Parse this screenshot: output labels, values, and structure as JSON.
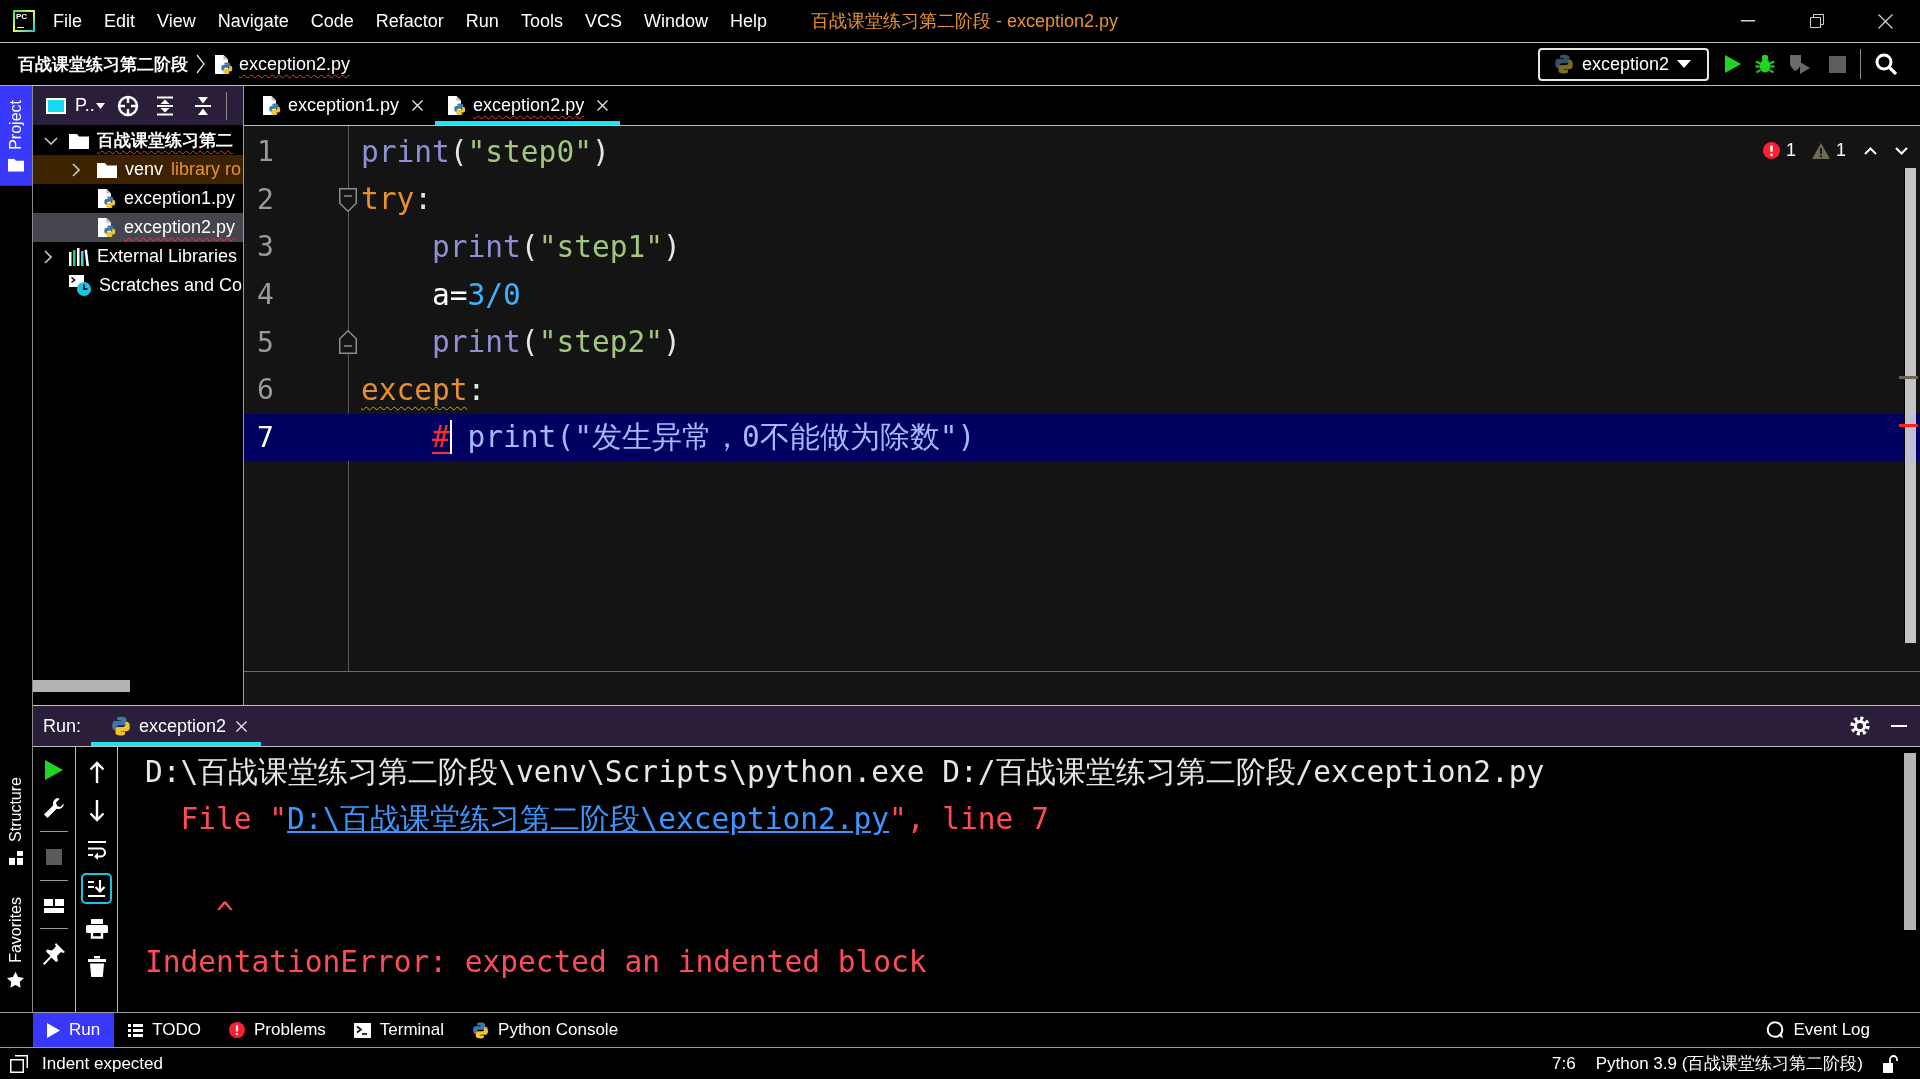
{
  "menu_bar": {
    "logo": "PC",
    "items": [
      "File",
      "Edit",
      "View",
      "Navigate",
      "Code",
      "Refactor",
      "Run",
      "Tools",
      "VCS",
      "Window",
      "Help"
    ],
    "title": "百战课堂练习第二阶段 - exception2.py"
  },
  "navigation_bar": {
    "breadcrumbs": [
      {
        "label": "百战课堂练习第二阶段",
        "kind": "project",
        "has_errors": false
      },
      {
        "label": "exception2.py",
        "kind": "file",
        "has_errors": true
      }
    ],
    "run_configuration": "exception2",
    "stop_enabled": false
  },
  "tool_strip": [
    {
      "label": "Project",
      "kind": "project",
      "selected": true
    },
    {
      "label": "Structure",
      "kind": "structure",
      "selected": false
    },
    {
      "label": "Favorites",
      "kind": "favorites",
      "selected": false
    }
  ],
  "project_panel": {
    "view": "P..",
    "tree": [
      {
        "label": "百战课堂练习第二",
        "kind": "project",
        "expanded": true,
        "selected": false,
        "has_errors": true,
        "children": [
          {
            "label": "venv",
            "note": "library ro",
            "kind": "folder",
            "expanded": false,
            "selected": false,
            "has_errors": false,
            "color": "#3d2200"
          },
          {
            "label": "exception1.py",
            "kind": "python-file",
            "selected": false,
            "has_errors": false
          },
          {
            "label": "exception2.py",
            "kind": "python-file",
            "selected": true,
            "has_errors": true
          }
        ]
      },
      {
        "label": "External Libraries",
        "kind": "libraries",
        "expanded": false,
        "selected": false,
        "has_errors": false
      },
      {
        "label": "Scratches and Co",
        "kind": "scratches",
        "selected": false,
        "has_errors": false
      }
    ]
  },
  "editor": {
    "tabs": [
      {
        "label": "exception1.py",
        "selected": false,
        "has_errors": false
      },
      {
        "label": "exception2.py",
        "selected": true,
        "has_errors": true
      }
    ],
    "inspections": {
      "errors": "1",
      "warnings": "1"
    },
    "lines": [
      {
        "number": "1",
        "current": false,
        "tokens": [
          {
            "text": "print",
            "kind": "builtin"
          },
          {
            "text": "(",
            "kind": "punct"
          },
          {
            "text": "\"step0\"",
            "kind": "string"
          },
          {
            "text": ")",
            "kind": "punct"
          }
        ]
      },
      {
        "number": "2",
        "current": false,
        "fold_start": true,
        "tokens": [
          {
            "text": "try",
            "kind": "keyword"
          },
          {
            "text": ":",
            "kind": "punct"
          }
        ]
      },
      {
        "number": "3",
        "current": false,
        "tokens": [
          {
            "text": "    print",
            "kind": "builtin"
          },
          {
            "text": "(",
            "kind": "punct"
          },
          {
            "text": "\"step1\"",
            "kind": "string"
          },
          {
            "text": ")",
            "kind": "punct"
          }
        ]
      },
      {
        "number": "4",
        "current": false,
        "tokens": [
          {
            "text": "    a=",
            "kind": "plain"
          },
          {
            "text": "3/0",
            "kind": "number"
          }
        ]
      },
      {
        "number": "5",
        "current": false,
        "fold_end": true,
        "tokens": [
          {
            "text": "    print",
            "kind": "builtin"
          },
          {
            "text": "(",
            "kind": "punct"
          },
          {
            "text": "\"step2\"",
            "kind": "string"
          },
          {
            "text": ")",
            "kind": "punct"
          }
        ]
      },
      {
        "number": "6",
        "current": false,
        "tokens": [
          {
            "text": "except",
            "kind": "keyword",
            "has_warning": true
          },
          {
            "text": ":",
            "kind": "punct"
          }
        ]
      },
      {
        "number": "7",
        "current": true,
        "tokens": [
          {
            "text": "    #",
            "kind": "comment",
            "has_error": true,
            "caret_after": true
          },
          {
            "text": " print(\"发生异常，0不能做为除数\")",
            "kind": "comment"
          }
        ]
      }
    ]
  },
  "run_panel": {
    "label": "Run:",
    "tabs": [
      {
        "label": "exception2",
        "selected": true
      }
    ],
    "stop_enabled": false,
    "scroll_to_end_on": true,
    "console": [
      {
        "kind": "output",
        "segments": [
          {
            "text": "D:\\百战课堂练习第二阶段\\venv\\Scripts\\python.exe D:/百战课堂练习第二阶段/exception2.py",
            "kind": "plain"
          }
        ]
      },
      {
        "kind": "output",
        "segments": [
          {
            "text": "  File \"",
            "kind": "error"
          },
          {
            "text": "D:\\百战课堂练习第二阶段\\exception2.py",
            "kind": "link"
          },
          {
            "text": "\", line 7",
            "kind": "error"
          }
        ]
      },
      {
        "kind": "blank"
      },
      {
        "kind": "output",
        "segments": [
          {
            "text": "    ^",
            "kind": "error"
          }
        ]
      },
      {
        "kind": "output",
        "segments": [
          {
            "text": "IndentationError: expected an indented block",
            "kind": "error"
          }
        ]
      }
    ]
  },
  "tool_window_bar": {
    "left": [
      {
        "label": "Run",
        "kind": "run",
        "selected": true
      },
      {
        "label": "TODO",
        "kind": "todo",
        "selected": false
      },
      {
        "label": "Problems",
        "kind": "problems",
        "selected": false
      },
      {
        "label": "Terminal",
        "kind": "terminal",
        "selected": false
      },
      {
        "label": "Python Console",
        "kind": "python-console",
        "selected": false
      }
    ],
    "right": [
      {
        "label": "Event Log",
        "kind": "event-log",
        "selected": false
      }
    ]
  },
  "status_bar": {
    "message": "Indent expected",
    "position": "7:6",
    "interpreter": "Python 3.9 (百战课堂练习第二阶段)"
  }
}
